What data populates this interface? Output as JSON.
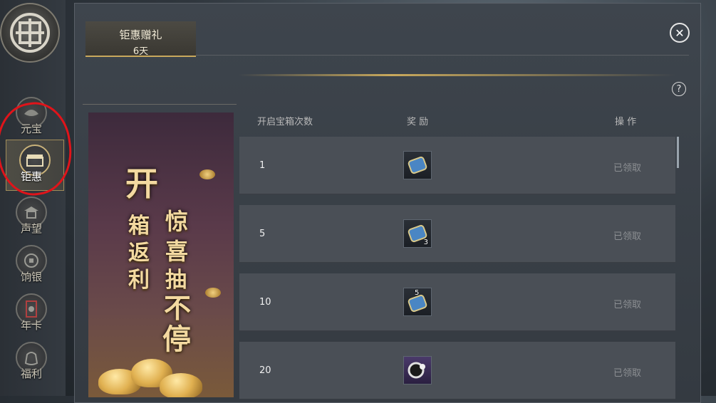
{
  "sidebar": {
    "items": [
      {
        "label": "元宝",
        "icon": "ingot-icon"
      },
      {
        "label": "钜惠",
        "icon": "chest-icon",
        "active": true
      },
      {
        "label": "声望",
        "icon": "pavilion-icon"
      },
      {
        "label": "饷银",
        "icon": "coin-icon"
      },
      {
        "label": "年卡",
        "icon": "card-icon"
      },
      {
        "label": "福利",
        "icon": "bag-icon"
      }
    ]
  },
  "tab": {
    "title": "钜惠赠礼",
    "subtitle": "6天"
  },
  "banner": {
    "line1": "开",
    "line2": "箱",
    "line3": "返",
    "line4": "利",
    "line5": "惊",
    "line6": "喜",
    "line7": "抽",
    "line8": "不",
    "line9": "停"
  },
  "table": {
    "headers": {
      "count": "开启宝箱次数",
      "reward": "奖 励",
      "action": "操 作"
    },
    "rows": [
      {
        "count": "1",
        "qty": "",
        "status": "已领取"
      },
      {
        "count": "5",
        "qty": "3",
        "status": "已领取"
      },
      {
        "count": "10",
        "qty": "5",
        "status": "已领取"
      },
      {
        "count": "20",
        "qty": "",
        "status": "已领取"
      }
    ]
  },
  "help": "?",
  "close": "✕",
  "colors": {
    "gold": "#c9a95c",
    "annotation_red": "#e0141a"
  }
}
